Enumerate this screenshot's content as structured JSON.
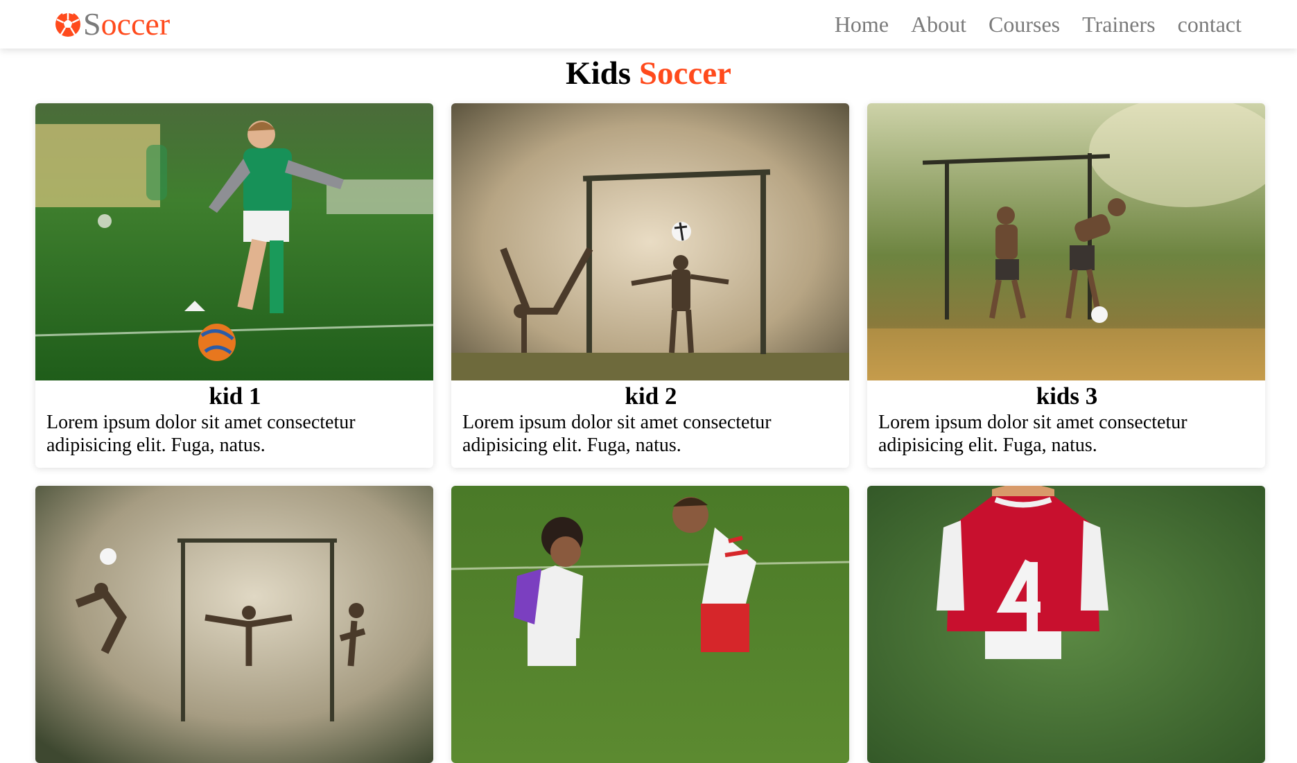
{
  "navbar": {
    "brand_icon": "soccer-ball-icon",
    "brand_prefix": "S",
    "brand_accent": "occer",
    "links": [
      "Home",
      "About",
      "Courses",
      "Trainers",
      "contact"
    ]
  },
  "section": {
    "title_part1": "Kids ",
    "title_part2": "Soccer"
  },
  "cards": [
    {
      "title": "kid 1",
      "text": "Lorem ipsum dolor sit amet consectetur adipisicing elit. Fuga, natus."
    },
    {
      "title": "kid 2",
      "text": "Lorem ipsum dolor sit amet consectetur adipisicing elit. Fuga, natus."
    },
    {
      "title": "kids 3",
      "text": "Lorem ipsum dolor sit amet consectetur adipisicing elit. Fuga, natus."
    },
    {
      "title": "",
      "text": ""
    },
    {
      "title": "",
      "text": ""
    },
    {
      "title": "",
      "text": ""
    }
  ],
  "colors": {
    "accent": "#ff4a1c",
    "nav_text": "#7a7a7a",
    "background": "#ffffff"
  }
}
